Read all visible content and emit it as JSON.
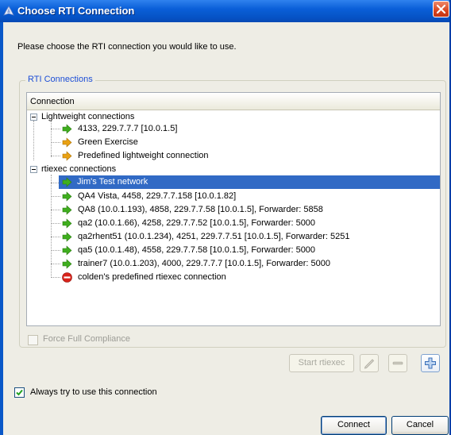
{
  "window": {
    "title": "Choose RTI Connection"
  },
  "intro_text": "Please choose the RTI connection you would like to use.",
  "group": {
    "label": "RTI Connections",
    "column_header": "Connection",
    "tree": [
      {
        "label": "Lightweight connections",
        "expanded": true,
        "children": [
          {
            "label": "4133, 229.7.7.7 [10.0.1.5]",
            "icon": "green-arrow-icon"
          },
          {
            "label": "Green Exercise",
            "icon": "orange-arrow-icon"
          },
          {
            "label": "Predefined lightweight connection",
            "icon": "orange-arrow-icon"
          }
        ]
      },
      {
        "label": "rtiexec connections",
        "expanded": true,
        "children": [
          {
            "label": "Jim's Test network",
            "icon": "green-arrow-icon",
            "selected": true
          },
          {
            "label": "QA4 Vista, 4458, 229.7.7.158 [10.0.1.82]",
            "icon": "green-arrow-icon"
          },
          {
            "label": "QA8 (10.0.1.193), 4858, 229.7.7.58 [10.0.1.5], Forwarder: 5858",
            "icon": "green-arrow-icon"
          },
          {
            "label": "qa2 (10.0.1.66), 4258, 229.7.7.52 [10.0.1.5], Forwarder: 5000",
            "icon": "green-arrow-icon"
          },
          {
            "label": "qa2rhent51 (10.0.1.234), 4251, 229.7.7.51 [10.0.1.5], Forwarder: 5251",
            "icon": "green-arrow-icon"
          },
          {
            "label": "qa5 (10.0.1.48), 4558, 229.7.7.58 [10.0.1.5], Forwarder: 5000",
            "icon": "green-arrow-icon"
          },
          {
            "label": "trainer7 (10.0.1.203), 4000, 229.7.7.7 [10.0.1.5], Forwarder: 5000",
            "icon": "green-arrow-icon"
          },
          {
            "label": "colden's predefined rtiexec connection",
            "icon": "red-no-entry-icon"
          }
        ]
      }
    ],
    "force_full_compliance": {
      "label": "Force Full Compliance",
      "checked": false,
      "enabled": false
    },
    "start_rtiexec_label": "Start rtiexec"
  },
  "always_use": {
    "label": "Always try to use this connection",
    "checked": true
  },
  "buttons": {
    "connect": "Connect",
    "cancel": "Cancel"
  },
  "colors": {
    "title_bar": "#0a5fd8",
    "selection": "#316ac5",
    "group_label": "#1c4ed6",
    "green_arrow": "#3fae1e",
    "orange_arrow": "#e9a112",
    "red_icon": "#d9231a"
  }
}
